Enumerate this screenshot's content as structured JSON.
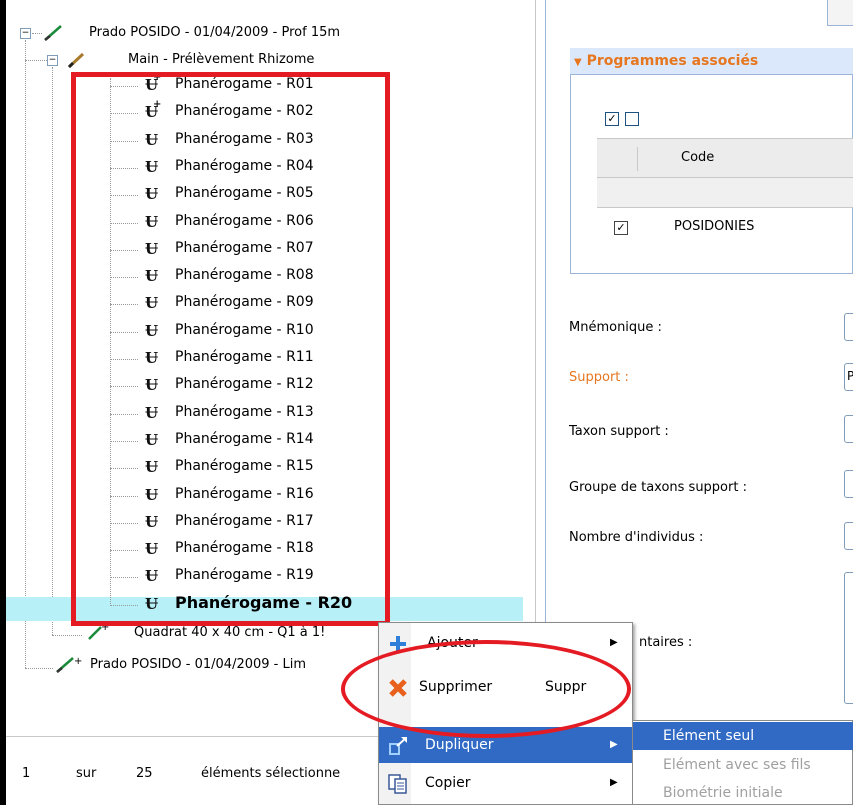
{
  "tree": {
    "root1_label": "Prado POSIDO - 01/04/2009 - Prof 15m",
    "main_label": "Main - Prélèvement Rhizome",
    "samples": [
      {
        "label": "Phanérogame - R01",
        "plus": true
      },
      {
        "label": "Phanérogame - R02",
        "plus": true
      },
      {
        "label": "Phanérogame - R03",
        "plus": false
      },
      {
        "label": "Phanérogame - R04",
        "plus": false
      },
      {
        "label": "Phanérogame - R05",
        "plus": false
      },
      {
        "label": "Phanérogame - R06",
        "plus": false
      },
      {
        "label": "Phanérogame - R07",
        "plus": false
      },
      {
        "label": "Phanérogame - R08",
        "plus": false
      },
      {
        "label": "Phanérogame - R09",
        "plus": false
      },
      {
        "label": "Phanérogame - R10",
        "plus": false
      },
      {
        "label": "Phanérogame - R11",
        "plus": false
      },
      {
        "label": "Phanérogame - R12",
        "plus": false
      },
      {
        "label": "Phanérogame - R13",
        "plus": false
      },
      {
        "label": "Phanérogame - R14",
        "plus": false
      },
      {
        "label": "Phanérogame - R15",
        "plus": false
      },
      {
        "label": "Phanérogame - R16",
        "plus": false
      },
      {
        "label": "Phanérogame - R17",
        "plus": false
      },
      {
        "label": "Phanérogame - R18",
        "plus": false
      },
      {
        "label": "Phanérogame - R19",
        "plus": false
      },
      {
        "label": "Phanérogame - R20",
        "plus": false,
        "selected": true
      }
    ],
    "quadrat_label": "Quadrat 40 x 40 cm - Q1 à 1!",
    "root2_label": "Prado POSIDO - 01/04/2009 - Lim"
  },
  "status": {
    "page": "1",
    "of_word": "sur",
    "total": "25",
    "selected_text": "éléments sélectionne"
  },
  "programs": {
    "header": "Programmes associés",
    "column_code": "Code",
    "row_code": "POSIDONIES"
  },
  "form": {
    "mnemonique": "Mnémonique :",
    "support": "Support :",
    "support_value": "P",
    "taxon_support": "Taxon support :",
    "groupe_taxons": "Groupe de taxons support :",
    "nombre_individus": "Nombre d'individus :",
    "commentaires": "ntaires :"
  },
  "context_menu": {
    "items": [
      {
        "label": "Ajouter",
        "shortcut": "",
        "submenu": true
      },
      {
        "label": "Supprimer",
        "shortcut": "Suppr",
        "submenu": false
      },
      {
        "label": "Dupliquer",
        "shortcut": "",
        "submenu": true
      },
      {
        "label": "Copier",
        "shortcut": "",
        "submenu": true
      }
    ],
    "dupliquer_submenu": [
      {
        "label": "Elément seul",
        "enabled": true
      },
      {
        "label": "Elément avec ses fils",
        "enabled": false
      },
      {
        "label": "Biométrie initiale",
        "enabled": false
      }
    ]
  },
  "colors": {
    "annotation_red": "#e41b23",
    "selection_highlight": "#b8f0f8",
    "menu_highlight": "#316ac5",
    "section_header_text": "#e6761f"
  }
}
